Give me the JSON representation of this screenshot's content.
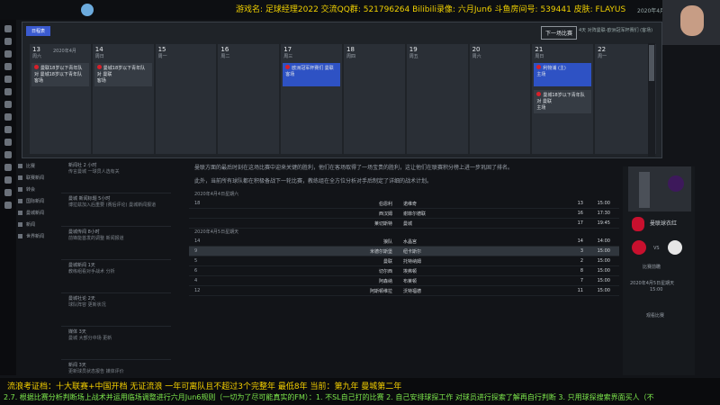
{
  "stream": {
    "ticker": "游戏名: 足球经理2022 交流QQ群: 521796264 Bilibili录像: 六月Jun6 斗鱼房间号: 539441 皮肤: FLAYUS",
    "top_date": "2020年4月",
    "caption_line1": "流浪考证档：十大联赛+中国开档 无证流浪 一年可离队且不超过3个完整年 最低8年 当前：第九年 曼城第二年",
    "caption_line2": "2.7. 根据比赛分析判断场上战术并运用临场调整进行六月Jun6规则（一切为了尽可能真实的FM）：1. 不SL自己打的比赛 2. 自己安排球探工作 对球员进行探索了解再自行判断 3. 只用球探搜索界面买人（不"
  },
  "calendar": {
    "badge": "日程表",
    "month": "2020年4月",
    "next_button": "下一场比赛",
    "tag": "4天 对阵曼联-欧洲冠军杯赛们 (客场)",
    "days": [
      {
        "num": "13",
        "weekday": "周六",
        "events": [
          {
            "text": "曼联18岁以下青年队 对 曼城18岁以下青年队",
            "sub": "客场",
            "style": "grey"
          }
        ]
      },
      {
        "num": "14",
        "weekday": "周日",
        "events": [
          {
            "text": "曼城18岁以下青年队 对 曼联",
            "sub": "客场",
            "style": "grey"
          }
        ]
      },
      {
        "num": "15",
        "weekday": "周一",
        "events": []
      },
      {
        "num": "16",
        "weekday": "周二",
        "events": []
      },
      {
        "num": "17",
        "weekday": "周三",
        "events": [
          {
            "text": "欧洲冠军杯赛们 曼联",
            "sub": "客场",
            "style": "blue"
          }
        ]
      },
      {
        "num": "18",
        "weekday": "周四",
        "events": []
      },
      {
        "num": "19",
        "weekday": "周五",
        "events": []
      },
      {
        "num": "20",
        "weekday": "周六",
        "events": []
      },
      {
        "num": "21",
        "weekday": "周日",
        "events": [
          {
            "text": "利物浦 (主)",
            "sub": "主场",
            "style": "blue"
          },
          {
            "text": "曼城18岁以下青年队 对 曼联",
            "sub": "主场",
            "style": "grey"
          }
        ]
      },
      {
        "num": "22",
        "weekday": "周一",
        "events": []
      }
    ]
  },
  "leftnav": [
    {
      "label": "比赛"
    },
    {
      "label": "联赛新闻"
    },
    {
      "label": "转会"
    },
    {
      "label": "国际新闻"
    },
    {
      "label": "曼城新闻"
    },
    {
      "label": "新闻"
    },
    {
      "label": "世界新闻"
    }
  ],
  "news": [
    {
      "title": "新闻社 2 小时",
      "text": "传言曼城 一球员人选有关"
    },
    {
      "title": "曼城 新闻标题 5小时",
      "text": "博拉兹加入后重要 (赛后评论) 曼城新闻报道"
    },
    {
      "title": "曼城传闻 8小时",
      "text": "前锋能首发的调整 新闻报道"
    },
    {
      "title": "曼城新闻 1天",
      "text": "教练组看对手战术 分析"
    },
    {
      "title": "曼城社论 2天",
      "text": "球队阵容 更新状况"
    },
    {
      "title": "媒体 3天",
      "text": "曼城 大部分中场 更新"
    },
    {
      "title": "新闻 3天",
      "text": "更新球员状态报告 媒体评价"
    },
    {
      "title": "新闻 4天",
      "text": "曼城青训 (体能) 报告 更新"
    }
  ],
  "article": {
    "para1": "曼联方面的最后时刻在这场比赛中迎来关键的胜利，他们在客场取得了一场宝贵的胜利，这让他们在联赛积分榜上进一步巩固了排名。",
    "para2": "此外，当前所有球队都在积极备战下一轮比赛，教练组在全方位分析对手后制定了详细的战术计划。",
    "sections": [
      {
        "header": "2020年4月4日星期六",
        "rows": [
          {
            "rank": "18",
            "home": "伯恩利",
            "away": "诺维奇",
            "r1": "13",
            "r2": "15:00"
          },
          {
            "rank": "",
            "home": "西汉姆",
            "away": "谢菲尔德联",
            "r1": "16",
            "r2": "17:30"
          },
          {
            "rank": "",
            "home": "莱切斯特",
            "away": "曼城",
            "r1": "17",
            "r2": "19:45"
          }
        ]
      },
      {
        "header": "2020年4月5日星期天",
        "rows": [
          {
            "rank": "14",
            "home": "狼队",
            "away": "水晶宫",
            "r1": "14",
            "r2": "14:00"
          },
          {
            "rank": "9",
            "home": "米德尔斯堡",
            "away": "纽卡斯尔",
            "r1": "3",
            "r2": "15:00",
            "sel": true
          },
          {
            "rank": "5",
            "home": "曼联",
            "away": "托特纳姆",
            "r1": "2",
            "r2": "15:00"
          },
          {
            "rank": "6",
            "home": "切尔西",
            "away": "埃弗顿",
            "r1": "8",
            "r2": "15:00"
          },
          {
            "rank": "4",
            "home": "阿森纳",
            "away": "布莱顿",
            "r1": "7",
            "r2": "15:00"
          },
          {
            "rank": "12",
            "home": "阿斯顿维拉",
            "away": "沃特福德",
            "r1": "11",
            "r2": "15:00"
          }
        ]
      }
    ]
  },
  "rightpanel": {
    "club": "曼联球衣红",
    "sub": "比赛前瞻",
    "vs": "VS",
    "date": "2020年4月5日星期天",
    "time": "15:00",
    "link": "观看比赛"
  }
}
